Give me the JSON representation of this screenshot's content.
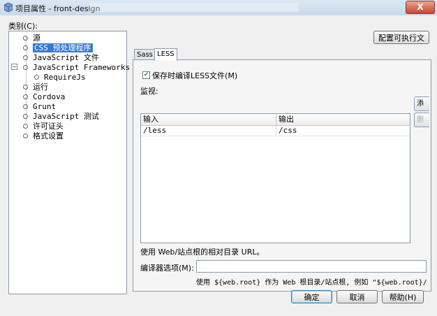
{
  "window": {
    "title": "项目属性 - front-design",
    "close_label": "X"
  },
  "categories": {
    "label": "类别(C):",
    "items": [
      {
        "label": "源"
      },
      {
        "label": "CSS 预处理程序"
      },
      {
        "label": "JavaScript 文件"
      },
      {
        "label": "JavaScript Frameworks"
      },
      {
        "label": "RequireJs"
      },
      {
        "label": "运行"
      },
      {
        "label": "Cordova"
      },
      {
        "label": "Grunt"
      },
      {
        "label": "JavaScript 测试"
      },
      {
        "label": "许可证头"
      },
      {
        "label": "格式设置"
      }
    ],
    "selected": "CSS 预处理程序"
  },
  "configure_button": "配置可执行文",
  "tabs": [
    {
      "label": "Sass"
    },
    {
      "label": "LESS"
    }
  ],
  "active_tab": "LESS",
  "compile_on_save": {
    "label": "保存时编译LESS文件(M)",
    "checked": true
  },
  "watch": {
    "label": "监视:",
    "columns": [
      "输入",
      "输出"
    ],
    "rows": [
      [
        "/less",
        "/css"
      ]
    ]
  },
  "side_buttons": [
    "添",
    "删"
  ],
  "hint_relative": "使用 Web/站点根的相对目录 URL。",
  "compiler_options": {
    "label": "编译器选项(M):",
    "value": ""
  },
  "compiler_hint": "使用 ${web.root} 作为 Web 根目录/站点根, 例如 \"${web.root}/in",
  "footer": {
    "ok": "确定",
    "cancel": "取消",
    "help": "帮助(H)"
  },
  "colors": {
    "selection": "#3b78d4",
    "accent": "#3c7fb1"
  },
  "icons": {
    "title": "netbeans-cube-icon",
    "checkbox": "check-icon"
  }
}
